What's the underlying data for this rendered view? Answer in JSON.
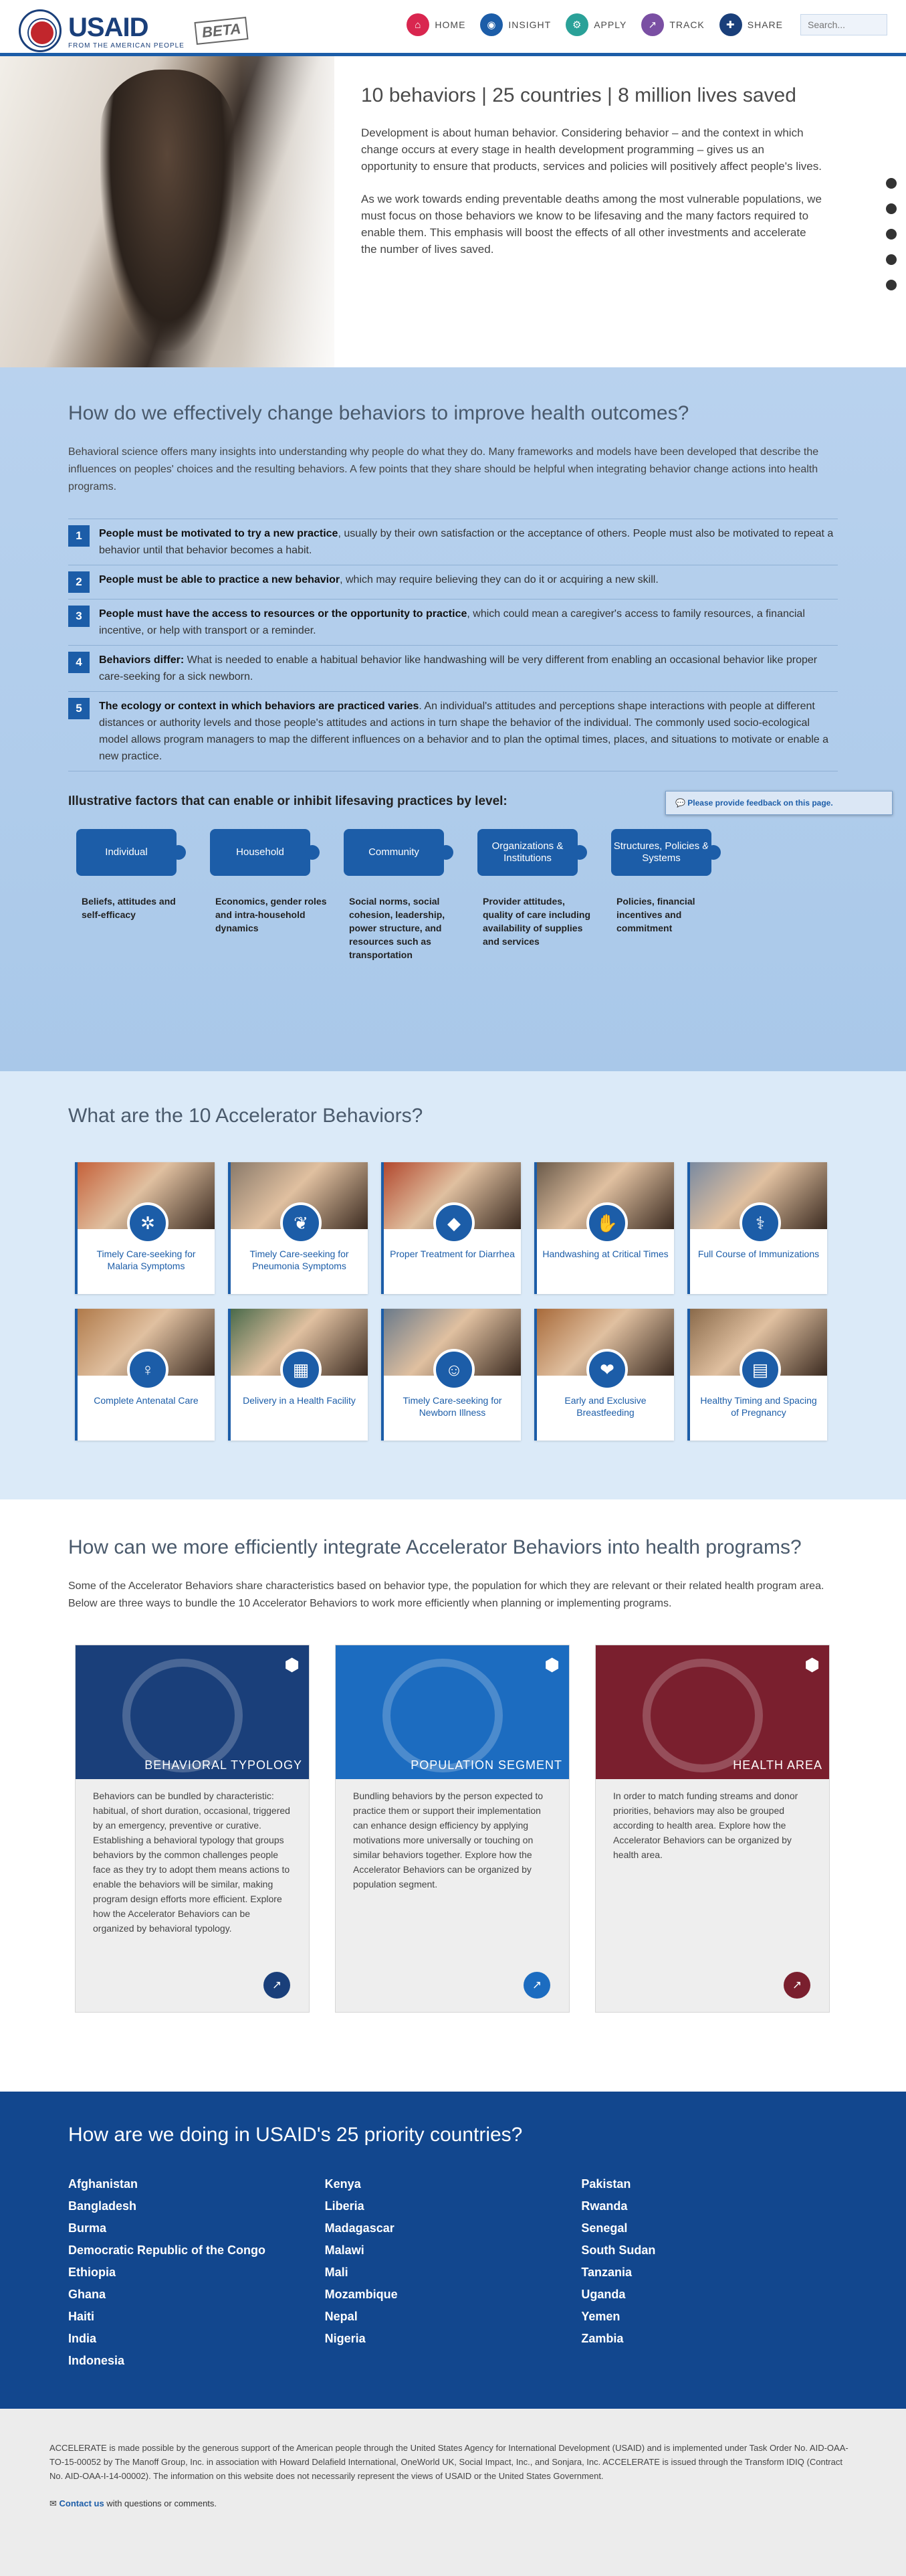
{
  "header": {
    "logo_text": "USAID",
    "logo_sub": "FROM THE AMERICAN PEOPLE",
    "beta": "BETA",
    "nav": [
      {
        "label": "HOME",
        "icon": "home-icon",
        "color": "#d9264f",
        "glyph": "⌂"
      },
      {
        "label": "INSIGHT",
        "icon": "insight-icon",
        "color": "#1c5da8",
        "glyph": "◉"
      },
      {
        "label": "APPLY",
        "icon": "apply-icon",
        "color": "#2aa198",
        "glyph": "⚙"
      },
      {
        "label": "TRACK",
        "icon": "track-icon",
        "color": "#7a4fa3",
        "glyph": "↗"
      },
      {
        "label": "SHARE",
        "icon": "share-icon",
        "color": "#1a3f7a",
        "glyph": "✚"
      }
    ],
    "search_placeholder": "Search..."
  },
  "hero": {
    "title": "10 behaviors | 25 countries | 8 million lives saved",
    "p1": "Development is about human behavior. Considering behavior – and the context in which change occurs at every stage in health development programming – gives us an opportunity to ensure that products, services and policies will positively affect people's lives.",
    "p2": "As we work towards ending preventable deaths among the most vulnerable populations, we must focus on those behaviors we know to be lifesaving and the many factors required to enable them. This emphasis will boost the effects of all other investments and accelerate the number of lives saved."
  },
  "change": {
    "title": "How do we effectively change behaviors to improve health outcomes?",
    "intro": "Behavioral science offers many insights into understanding why people do what they do. Many frameworks and models have been developed that describe the influences on peoples' choices and the resulting behaviors. A few points that they share should be helpful when integrating behavior change actions into health programs.",
    "points": [
      {
        "n": "1",
        "bold": "People must be motivated to try a new practice",
        "rest": ", usually by their own satisfaction or the acceptance of others. People must also be motivated to repeat a behavior until that behavior becomes a habit."
      },
      {
        "n": "2",
        "bold": "People must be able to practice a new behavior",
        "rest": ", which may require believing they can do it or acquiring a new skill."
      },
      {
        "n": "3",
        "bold": "People must have the access to resources or the opportunity to practice",
        "rest": ", which could mean a caregiver's access to family resources, a financial incentive, or help with transport or a reminder."
      },
      {
        "n": "4",
        "bold": "Behaviors differ:",
        "rest": " What is needed to enable a habitual behavior like handwashing will be very different from enabling an occasional behavior like proper care-seeking for a sick newborn."
      },
      {
        "n": "5",
        "bold": "The ecology or context in which behaviors are practiced varies",
        "rest": ". An individual's attitudes and perceptions shape interactions with people at different distances or authority levels and those people's attitudes and actions in turn shape the behavior of the individual. The commonly used socio-ecological model allows program managers to map the different influences on a behavior and to plan the optimal times, places, and situations to motivate or enable a new practice."
      }
    ],
    "feedback": "Please provide feedback on this page.",
    "factors_title": "Illustrative factors that can enable or inhibit lifesaving practices by level:",
    "factors": [
      {
        "label": "Individual",
        "desc": "Beliefs, attitudes and self-efficacy"
      },
      {
        "label": "Household",
        "desc": "Economics, gender roles and intra-household dynamics"
      },
      {
        "label": "Community",
        "desc": "Social norms, social cohesion, leadership, power structure, and resources such as transportation"
      },
      {
        "label": "Organizations & Institutions",
        "desc": "Provider attitudes, quality of care including availability of supplies and services"
      },
      {
        "label": "Structures, Policies & Systems",
        "desc": "Policies, financial incentives and commitment"
      }
    ]
  },
  "accelerators": {
    "title": "What are the 10 Accelerator Behaviors?",
    "items": [
      {
        "label": "Timely Care-seeking for Malaria Symptoms",
        "icon": "mosquito-icon",
        "glyph": "✲"
      },
      {
        "label": "Timely Care-seeking for Pneumonia Symptoms",
        "icon": "lungs-icon",
        "glyph": "❦"
      },
      {
        "label": "Proper Treatment for Diarrhea",
        "icon": "ors-packet-icon",
        "glyph": "◆"
      },
      {
        "label": "Handwashing at Critical Times",
        "icon": "handwashing-icon",
        "glyph": "✋"
      },
      {
        "label": "Full Course of Immunizations",
        "icon": "syringe-icon",
        "glyph": "⚕"
      },
      {
        "label": "Complete Antenatal Care",
        "icon": "pregnancy-icon",
        "glyph": "♀"
      },
      {
        "label": "Delivery in a Health Facility",
        "icon": "hospital-icon",
        "glyph": "▦"
      },
      {
        "label": "Timely Care-seeking for Newborn Illness",
        "icon": "newborn-icon",
        "glyph": "☺"
      },
      {
        "label": "Early and Exclusive Breastfeeding",
        "icon": "breastfeeding-icon",
        "glyph": "❤"
      },
      {
        "label": "Healthy Timing and Spacing of Pregnancy",
        "icon": "calendar-icon",
        "glyph": "▤"
      }
    ]
  },
  "integrate": {
    "title": "How can we more efficiently integrate Accelerator Behaviors into health programs?",
    "intro": "Some of the Accelerator Behaviors share characteristics based on behavior type, the population for which they are relevant or their related health program area. Below are three ways to bundle the 10 Accelerator Behaviors to work more efficiently when planning or implementing programs.",
    "cards": [
      {
        "title": "BEHAVIORAL TYPOLOGY",
        "color": "#1a3f7a",
        "body": "Behaviors can be bundled by characteristic: habitual, of short duration, occasional, triggered by an emergency, preventive or curative. Establishing a behavioral typology that groups behaviors by the common challenges people face as they try to adopt them means actions to enable the behaviors will be similar, making program design efforts more efficient. Explore how the Accelerator Behaviors can be organized by behavioral typology."
      },
      {
        "title": "POPULATION SEGMENT",
        "color": "#1c6cc0",
        "body": "Bundling behaviors by the person expected to practice them or support their implementation can enhance design efficiency by applying motivations more universally or touching on similar behaviors together. Explore how the Accelerator Behaviors can be organized by population segment."
      },
      {
        "title": "HEALTH AREA",
        "color": "#7a1f2e",
        "body": "In order to match funding streams and donor priorities, behaviors may also be grouped according to health area. Explore how the Accelerator Behaviors can be organized by health area."
      }
    ]
  },
  "countries": {
    "title": "How are we doing in USAID's 25 priority countries?",
    "col1": [
      "Afghanistan",
      "Bangladesh",
      "Burma",
      "Democratic Republic of the Congo",
      "Ethiopia",
      "Ghana",
      "Haiti",
      "India",
      "Indonesia"
    ],
    "col2": [
      "Kenya",
      "Liberia",
      "Madagascar",
      "Malawi",
      "Mali",
      "Mozambique",
      "Nepal",
      "Nigeria"
    ],
    "col3": [
      "Pakistan",
      "Rwanda",
      "Senegal",
      "South Sudan",
      "Tanzania",
      "Uganda",
      "Yemen",
      "Zambia"
    ]
  },
  "footer": {
    "text": "ACCELERATE is made possible by the generous support of the American people through the United States Agency for International Development (USAID) and is implemented under Task Order No. AID-OAA-TO-15-00052 by The Manoff Group, Inc. in association with Howard Delafield International, OneWorld UK, Social Impact, Inc., and Sonjara, Inc. ACCELERATE is issued through the Transform IDIQ (Contract No. AID-OAA-I-14-00002). The information on this website does not necessarily represent the views of USAID or the United States Government.",
    "contact_link": "Contact us",
    "contact_rest": " with questions or comments."
  }
}
